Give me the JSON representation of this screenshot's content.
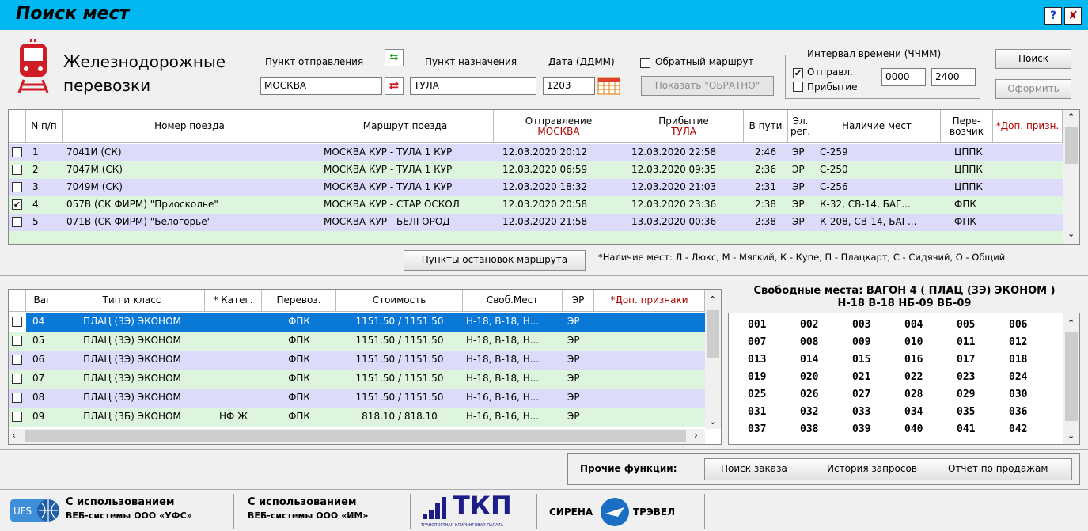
{
  "window": {
    "title": "Поиск мест",
    "help_label": "?",
    "close_label": "✘"
  },
  "logo": {
    "line1": "Железнодорожные",
    "line2": "перевозки"
  },
  "form": {
    "departure_label": "Пункт отправления",
    "departure_value": "МОСКВА",
    "destination_label": "Пункт назначения",
    "destination_value": "ТУЛА",
    "date_label": "Дата (ДДММ)",
    "date_value": "1203",
    "return_route_label": "Обратный маршрут",
    "show_return_label": "Показать \"ОБРАТНО\"",
    "interval_legend": "Интервал времени (ЧЧММ)",
    "depart_check_label": "Отправл.",
    "arrive_check_label": "Прибытие",
    "time_from": "0000",
    "time_to": "2400",
    "search_button": "Поиск",
    "issue_button": "Оформить"
  },
  "trains": {
    "headers": {
      "num": "N п/п",
      "train": "Номер поезда",
      "route": "Маршрут поезда",
      "dep": "Отправление",
      "dep_city": "МОСКВА",
      "arr": "Прибытие",
      "arr_city": "ТУЛА",
      "travel": "В пути",
      "el": "Эл. рег.",
      "avail": "Наличие мест",
      "carrier": "Пере- возчик",
      "extra": "*Доп. призн."
    },
    "rows": [
      {
        "checked": "",
        "num": "1",
        "train": "7041И  (СК)",
        "route": "МОСКВА КУР - ТУЛА 1 КУР",
        "dep": "12.03.2020  20:12",
        "arr": "12.03.2020  22:58",
        "travel": "2:46",
        "el": "ЭР",
        "avail": "С-259",
        "carrier": "ЦППК"
      },
      {
        "checked": "",
        "num": "2",
        "train": "7047М  (СК)",
        "route": "МОСКВА КУР - ТУЛА 1 КУР",
        "dep": "12.03.2020  06:59",
        "arr": "12.03.2020  09:35",
        "travel": "2:36",
        "el": "ЭР",
        "avail": "С-250",
        "carrier": "ЦППК"
      },
      {
        "checked": "",
        "num": "3",
        "train": "7049М  (СК)",
        "route": "МОСКВА КУР - ТУЛА 1 КУР",
        "dep": "12.03.2020  18:32",
        "arr": "12.03.2020  21:03",
        "travel": "2:31",
        "el": "ЭР",
        "avail": "С-256",
        "carrier": "ЦППК"
      },
      {
        "checked": "✔",
        "num": "4",
        "train": "057В  (СК ФИРМ)  \"Приосколье\"",
        "route": "МОСКВА КУР - СТАР ОСКОЛ",
        "dep": "12.03.2020  20:58",
        "arr": "12.03.2020  23:36",
        "travel": "2:38",
        "el": "ЭР",
        "avail": "К-32, СВ-14, БАГ...",
        "carrier": "ФПК"
      },
      {
        "checked": "",
        "num": "5",
        "train": "071В  (СК ФИРМ)  \"Белогорье\"",
        "route": "МОСКВА КУР - БЕЛГОРОД",
        "dep": "12.03.2020  21:58",
        "arr": "13.03.2020  00:36",
        "travel": "2:38",
        "el": "ЭР",
        "avail": "К-208, СВ-14, БАГ...",
        "carrier": "ФПК"
      }
    ]
  },
  "stops_button": "Пункты остановок маршрута",
  "legend_note": "*Наличие мест:  Л - Люкс, М - Мягкий, К - Купе, П - Плацкарт,  С - Сидячий, О - Общий",
  "cars": {
    "headers": {
      "car": "Ваг",
      "type": "Тип и класс",
      "cat": "* Катег.",
      "carrier": "Перевоз.",
      "price": "Стоимость",
      "free": "Своб.Мест",
      "er": "ЭР",
      "extra": "*Доп. признаки"
    },
    "rows": [
      {
        "car": "04",
        "type": "ПЛАЦ (3Э) ЭКОНОМ",
        "cat": "",
        "carrier": "ФПК",
        "price": "1151.50 / 1151.50",
        "free": "Н-18, В-18, Н...",
        "er": "ЭР"
      },
      {
        "car": "05",
        "type": "ПЛАЦ (3Э) ЭКОНОМ",
        "cat": "",
        "carrier": "ФПК",
        "price": "1151.50 / 1151.50",
        "free": "Н-18, В-18, Н...",
        "er": "ЭР"
      },
      {
        "car": "06",
        "type": "ПЛАЦ (3Э) ЭКОНОМ",
        "cat": "",
        "carrier": "ФПК",
        "price": "1151.50 / 1151.50",
        "free": "Н-18, В-18, Н...",
        "er": "ЭР"
      },
      {
        "car": "07",
        "type": "ПЛАЦ (3Э) ЭКОНОМ",
        "cat": "",
        "carrier": "ФПК",
        "price": "1151.50 / 1151.50",
        "free": "Н-18, В-18, Н...",
        "er": "ЭР"
      },
      {
        "car": "08",
        "type": "ПЛАЦ (3Э) ЭКОНОМ",
        "cat": "",
        "carrier": "ФПК",
        "price": "1151.50 / 1151.50",
        "free": "Н-16, В-16, Н...",
        "er": "ЭР"
      },
      {
        "car": "09",
        "type": "ПЛАЦ (3Б) ЭКОНОМ",
        "cat": "НФ Ж",
        "carrier": "ФПК",
        "price": "818.10 / 818.10",
        "free": "Н-16, В-16, Н...",
        "er": "ЭР"
      }
    ]
  },
  "free_seats": {
    "title_line1": "Свободные места: ВАГОН 4 ( ПЛАЦ (3Э) ЭКОНОМ )",
    "title_line2": "Н-18 В-18 НБ-09 ВБ-09",
    "seats": [
      "001",
      "002",
      "003",
      "004",
      "005",
      "006",
      "007",
      "008",
      "009",
      "010",
      "011",
      "012",
      "013",
      "014",
      "015",
      "016",
      "017",
      "018",
      "019",
      "020",
      "021",
      "022",
      "023",
      "024",
      "025",
      "026",
      "027",
      "028",
      "029",
      "030",
      "031",
      "032",
      "033",
      "034",
      "035",
      "036",
      "037",
      "038",
      "039",
      "040",
      "041",
      "042"
    ]
  },
  "other": {
    "label": "Прочие функции:",
    "order_search": "Поиск заказа",
    "history": "История запросов",
    "sales_report": "Отчет по продажам"
  },
  "footer": {
    "ufs_line1": "С использованием",
    "ufs_line2": "ВЕБ-системы ООО «УФС»",
    "im_line1": "С использованием",
    "im_line2": "ВЕБ-системы ООО «ИМ»",
    "tkp_text": "ТКП",
    "tkp_caption": "ТРАНСПОРТНАЯ КЛИРИНГОВАЯ ПАЛАТА",
    "sirena_left": "СИРЕНА",
    "sirena_right": "ТРЭВЕЛ"
  },
  "colors": {
    "titlebar": "#00b7ef",
    "row_purple": "#dcdcfa",
    "row_green": "#dcf5dc",
    "selected": "#0a78d7"
  }
}
